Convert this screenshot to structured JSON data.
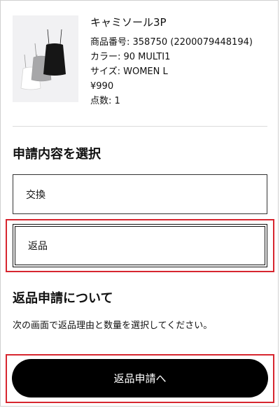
{
  "product": {
    "image_icon": "camisole-set-image",
    "name": "キャミソール3P",
    "product_number": "商品番号: 358750 (2200079448194)",
    "color": "カラー: 90 MULTI1",
    "size": "サイズ: WOMEN L",
    "price": "¥990",
    "quantity": "点数: 1"
  },
  "select_section": {
    "title": "申請内容を選択",
    "options": [
      {
        "label": "交換",
        "selected": false
      },
      {
        "label": "返品",
        "selected": true
      }
    ]
  },
  "about_section": {
    "title": "返品申請について",
    "description": "次の画面で返品理由と数量を選択してください。"
  },
  "submit": {
    "label": "返品申請へ"
  },
  "colors": {
    "highlight": "#d7262f",
    "button_bg": "#000000",
    "button_text": "#ffffff",
    "thumb_bg": "#f1f1f3"
  }
}
